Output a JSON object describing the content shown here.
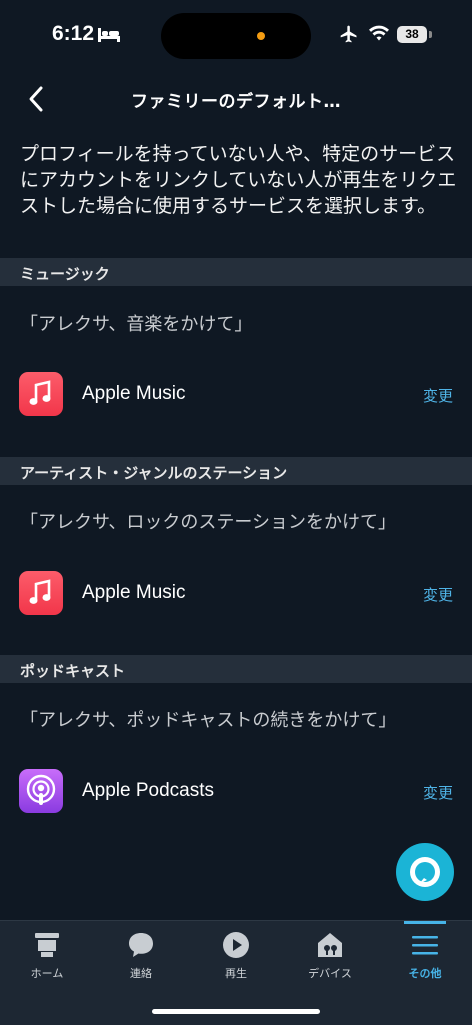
{
  "status_bar": {
    "time": "6:12",
    "battery": "38"
  },
  "header": {
    "title": "ファミリーのデフォルト…"
  },
  "description": "プロフィールを持っていない人や、特定のサービスにアカウントをリンクしていない人が再生をリクエストした場合に使用するサービスを選択します。",
  "sections": [
    {
      "title": "ミュージック",
      "example": "「アレクサ、音楽をかけて」",
      "service": "Apple Music",
      "icon": "apple-music-icon",
      "change_label": "変更"
    },
    {
      "title": "アーティスト・ジャンルのステーション",
      "example": "「アレクサ、ロックのステーションをかけて」",
      "service": "Apple Music",
      "icon": "apple-music-icon",
      "change_label": "変更"
    },
    {
      "title": "ポッドキャスト",
      "example": "「アレクサ、ポッドキャストの続きをかけて」",
      "service": "Apple Podcasts",
      "icon": "apple-podcasts-icon",
      "change_label": "変更"
    }
  ],
  "tabs": [
    {
      "label": "ホーム",
      "icon": "home-icon",
      "active": false
    },
    {
      "label": "連絡",
      "icon": "chat-bubble-icon",
      "active": false
    },
    {
      "label": "再生",
      "icon": "play-icon",
      "active": false
    },
    {
      "label": "デバイス",
      "icon": "devices-icon",
      "active": false
    },
    {
      "label": "その他",
      "icon": "menu-icon",
      "active": true
    }
  ],
  "colors": {
    "background": "#0f1823",
    "section_bg": "#252f3b",
    "accent": "#47b4e8",
    "alexa": "#1bb4d6"
  }
}
